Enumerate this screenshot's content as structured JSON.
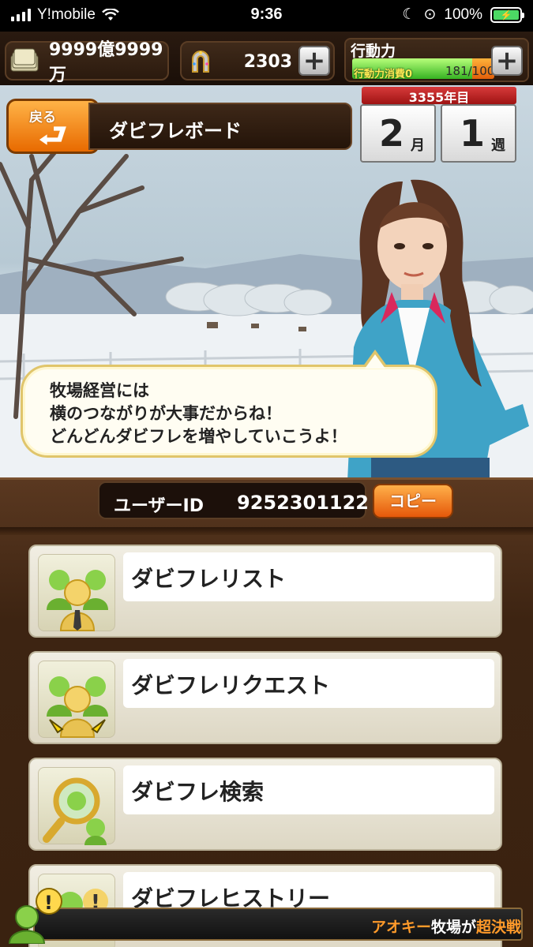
{
  "status_bar": {
    "carrier": "Y!mobile",
    "time": "9:36",
    "battery": "100%"
  },
  "resources": {
    "money": "9999億9999万",
    "horseshoes": "2303",
    "action_label": "行動力",
    "action_cost": "行動力消費0",
    "action_points": "181/100"
  },
  "calendar": {
    "year": "3355年目",
    "month": "2",
    "month_unit": "月",
    "week": "1",
    "week_unit": "週"
  },
  "header": {
    "back_label": "戻る",
    "title": "ダビフレボード"
  },
  "speech": {
    "line1": "牧場経営には",
    "line2": "横のつながりが大事だからね！",
    "line3": "どんどんダビフレを増やしていこうよ！"
  },
  "user": {
    "id_label": "ユーザーID",
    "id_value": "9252301122",
    "copy_label": "コピー"
  },
  "menu": {
    "items": [
      {
        "label": "ダビフレリスト"
      },
      {
        "label": "ダビフレリクエスト"
      },
      {
        "label": "ダビフレ検索"
      },
      {
        "label": "ダビフレヒストリー"
      }
    ]
  },
  "ticker": {
    "name": "アオキー",
    "text": "牧場が",
    "highlight": "超決戦"
  }
}
